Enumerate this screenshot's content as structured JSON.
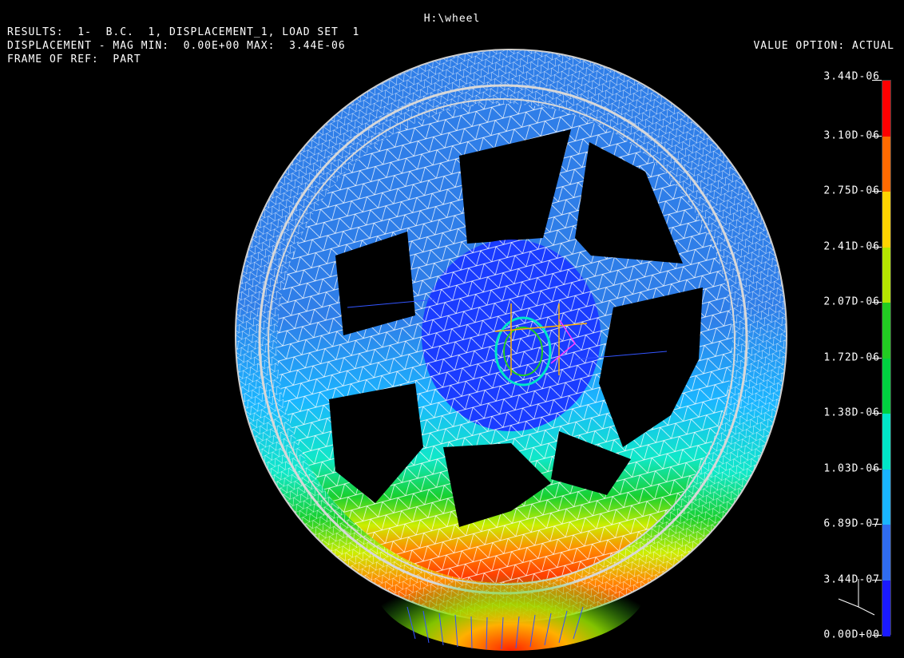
{
  "header": {
    "title": "H:\\wheel",
    "results_line": "RESULTS:  1-  B.C.  1, DISPLACEMENT_1, LOAD SET  1",
    "displacement_line": "DISPLACEMENT - MAG MIN:  0.00E+00 MAX:  3.44E-06",
    "frame_line": "FRAME OF REF:  PART",
    "value_option": "VALUE OPTION: ACTUAL"
  },
  "legend": {
    "labels": [
      "3.44D-06",
      "3.10D-06",
      "2.75D-06",
      "2.41D-06",
      "2.07D-06",
      "1.72D-06",
      "1.38D-06",
      "1.03D-06",
      "6.89D-07",
      "3.44D-07",
      "0.00D+00"
    ],
    "colors_top_to_bottom": [
      "#ff0000",
      "#ff6a00",
      "#ffd400",
      "#b4e600",
      "#22cc22",
      "#00d040",
      "#00e6c8",
      "#19b4ff",
      "#2f6cf0",
      "#1a1aff"
    ]
  },
  "model": {
    "name": "wheel",
    "field": "displacement magnitude",
    "min": 0.0,
    "max": 3.44e-06
  },
  "colors": {
    "background": "#000000",
    "mesh": "#ffffff",
    "text": "#ffffff"
  }
}
